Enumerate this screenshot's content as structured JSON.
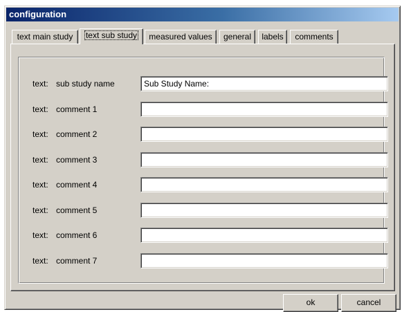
{
  "window": {
    "title": "configuration"
  },
  "tabs": [
    {
      "label": "text main study",
      "active": false
    },
    {
      "label": "text sub study",
      "active": true
    },
    {
      "label": "measured values",
      "active": false
    },
    {
      "label": "general",
      "active": false
    },
    {
      "label": "labels",
      "active": false
    },
    {
      "label": "comments",
      "active": false
    }
  ],
  "form": {
    "rows": [
      {
        "prefix": "text:",
        "label": "sub study name",
        "value": "Sub Study Name:"
      },
      {
        "prefix": "text:",
        "label": "comment 1",
        "value": ""
      },
      {
        "prefix": "text:",
        "label": "comment 2",
        "value": ""
      },
      {
        "prefix": "text:",
        "label": "comment 3",
        "value": ""
      },
      {
        "prefix": "text:",
        "label": "comment 4",
        "value": ""
      },
      {
        "prefix": "text:",
        "label": "comment 5",
        "value": ""
      },
      {
        "prefix": "text:",
        "label": "comment 6",
        "value": ""
      },
      {
        "prefix": "text:",
        "label": "comment 7",
        "value": ""
      }
    ]
  },
  "buttons": {
    "ok_label": "ok",
    "cancel_label": "cancel"
  },
  "colors": {
    "face": "#d4d0c8",
    "titlebar_start": "#0a246a",
    "titlebar_end": "#a6caf0"
  }
}
